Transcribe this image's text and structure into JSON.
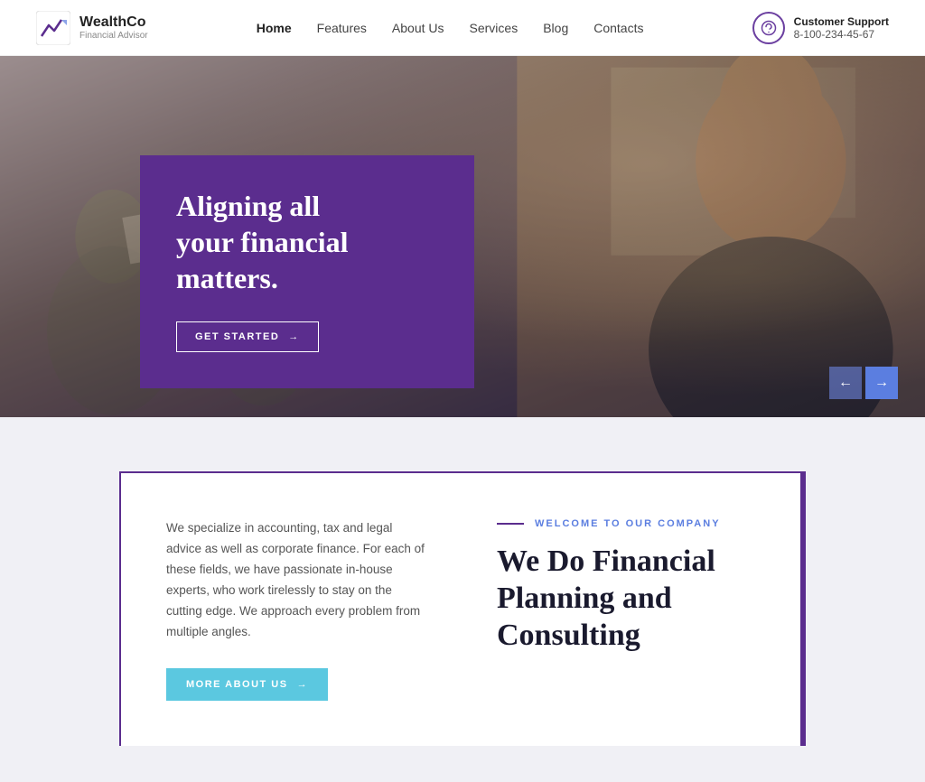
{
  "header": {
    "logo": {
      "name": "WealthCo",
      "tagline": "Financial Advisor"
    },
    "nav": {
      "items": [
        {
          "label": "Home",
          "active": true
        },
        {
          "label": "Features",
          "active": false
        },
        {
          "label": "About Us",
          "active": false
        },
        {
          "label": "Services",
          "active": false
        },
        {
          "label": "Blog",
          "active": false
        },
        {
          "label": "Contacts",
          "active": false
        }
      ]
    },
    "support": {
      "label": "Customer Support",
      "phone": "8-100-234-45-67"
    }
  },
  "hero": {
    "heading_line1": "Aligning all",
    "heading_line2": "your financial",
    "heading_line3": "matters.",
    "cta_label": "GET STARTED",
    "arrow_left": "←",
    "arrow_right": "→"
  },
  "section": {
    "welcome_label": "WELCOME TO OUR COMPANY",
    "body_text": "We specialize in accounting, tax and legal advice as well as corporate finance. For each of these fields, we have passionate in-house experts, who work tirelessly to stay on the cutting edge. We approach every problem from multiple angles.",
    "more_btn_label": "MORE ABOUT US",
    "heading_line1": "We Do Financial",
    "heading_line2": "Planning and",
    "heading_line3": "Consulting"
  }
}
